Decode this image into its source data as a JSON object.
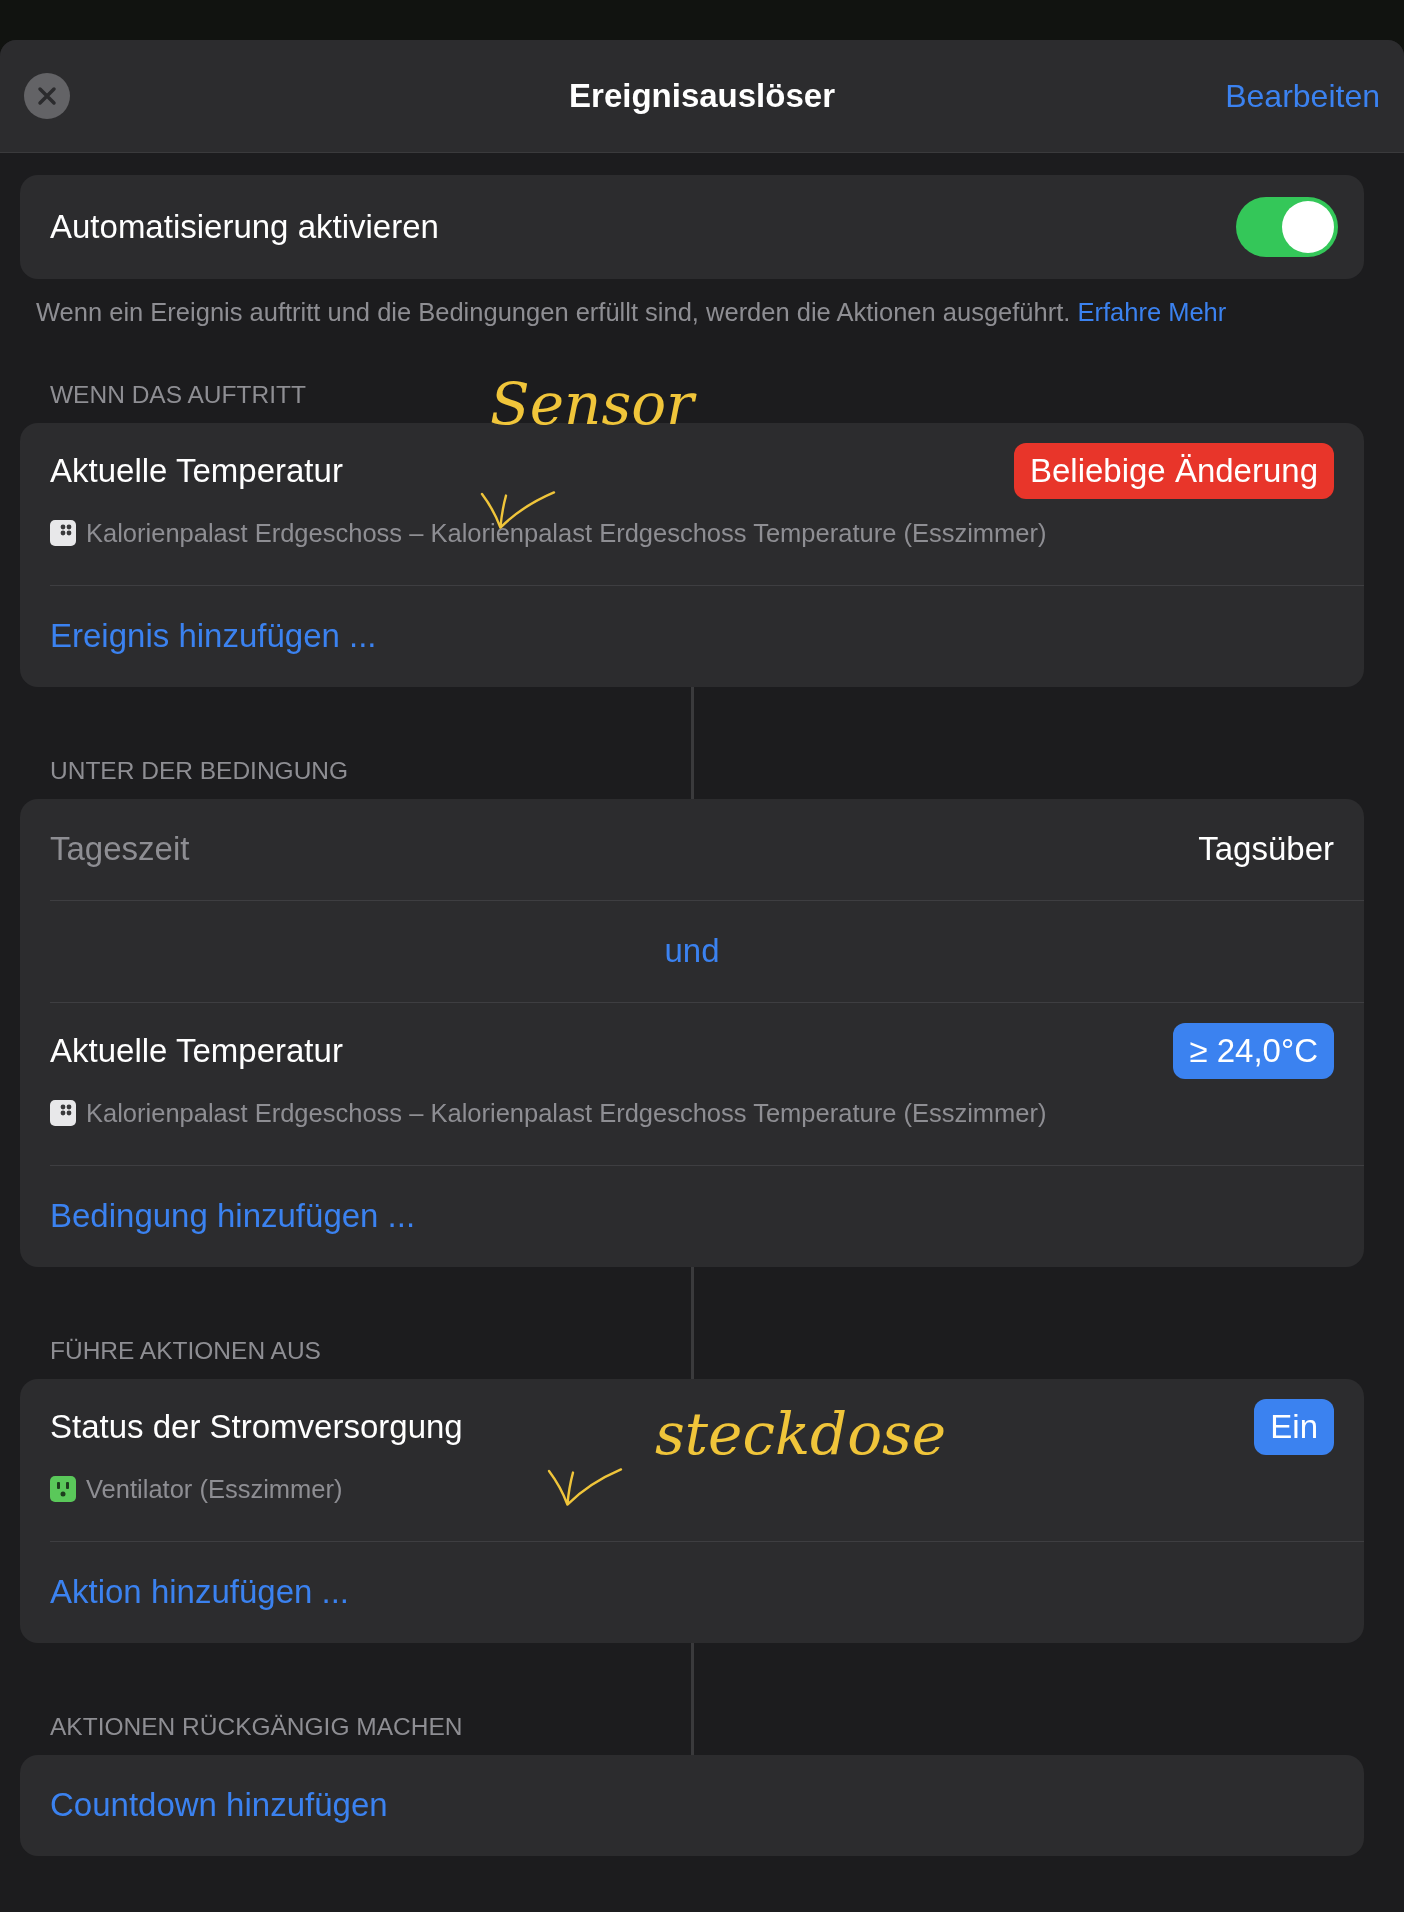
{
  "header": {
    "title": "Ereignisauslöser",
    "edit": "Bearbeiten"
  },
  "enable": {
    "label": "Automatisierung aktivieren",
    "on": true
  },
  "footer": {
    "text": "Wenn ein Ereignis auftritt und die Bedingungen erfüllt sind, werden die Aktionen ausgeführt.",
    "link": "Erfahre Mehr"
  },
  "sections": [
    {
      "title": "WENN DAS AUFTRITT",
      "rows": [
        {
          "kind": "item",
          "title": "Aktuelle Temperatur",
          "badge": "Beliebige Änderung",
          "color": "#e8352a",
          "device": {
            "kind": "sensor",
            "name": "Kalorienpalast Erdgeschoss – Kalorienpalast Erdgeschoss Temperature (Esszimmer)"
          }
        },
        {
          "kind": "add",
          "label": "Ereignis hinzufügen ..."
        }
      ]
    },
    {
      "title": "UNTER DER BEDINGUNG",
      "rows": [
        {
          "kind": "value",
          "title": "Tageszeit",
          "value": "Tagsüber"
        },
        {
          "kind": "joiner",
          "label": "und"
        },
        {
          "kind": "item",
          "title": "Aktuelle Temperatur",
          "badge": "≥ 24,0°C",
          "color": "#3b82f0",
          "device": {
            "kind": "sensor",
            "name": "Kalorienpalast Erdgeschoss – Kalorienpalast Erdgeschoss Temperature (Esszimmer)"
          }
        },
        {
          "kind": "add",
          "label": "Bedingung hinzufügen ..."
        }
      ]
    },
    {
      "title": "FÜHRE AKTIONEN AUS",
      "rows": [
        {
          "kind": "item",
          "title": "Status der Stromversorgung",
          "badge": "Ein",
          "color": "#3b82f0",
          "device": {
            "kind": "outlet",
            "name": "Ventilator (Esszimmer)"
          }
        },
        {
          "kind": "add",
          "label": "Aktion hinzufügen ..."
        }
      ]
    },
    {
      "title": "AKTIONEN RÜCKGÄNGIG MACHEN",
      "rows": [
        {
          "kind": "add",
          "label": "Countdown hinzufügen"
        }
      ]
    }
  ],
  "annotations": [
    {
      "text": "Sensor"
    },
    {
      "text": "steckdose"
    }
  ]
}
